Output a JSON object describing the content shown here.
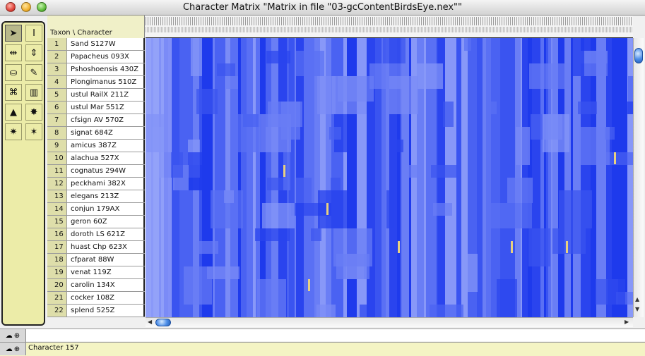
{
  "window": {
    "title": "Character Matrix \"Matrix in file \"03-gcContentBirdsEye.nex\"\""
  },
  "header": {
    "corner_label": "Taxon  \\  Character"
  },
  "tools": [
    {
      "name": "arrow-tool-icon",
      "glyph": "➤",
      "active": true
    },
    {
      "name": "ibeam-tool-icon",
      "glyph": "I",
      "active": false
    },
    {
      "name": "column-adjust-tool-icon",
      "glyph": "⇹",
      "active": false
    },
    {
      "name": "row-adjust-tool-icon",
      "glyph": "⇕",
      "active": false
    },
    {
      "name": "fill-bucket-tool-icon",
      "glyph": "⛀",
      "active": false
    },
    {
      "name": "dropper-tool-icon",
      "glyph": "✎",
      "active": false
    },
    {
      "name": "select-tool-icon",
      "glyph": "⌘",
      "active": false
    },
    {
      "name": "column-width-tool-icon",
      "glyph": "▥",
      "active": false
    },
    {
      "name": "pyramid-tool-icon",
      "glyph": "▲",
      "active": false
    },
    {
      "name": "magic-wand-tool-icon",
      "glyph": "✸",
      "active": false
    },
    {
      "name": "wand-menu-tool-icon",
      "glyph": "✷",
      "active": false
    },
    {
      "name": "wand-alt-tool-icon",
      "glyph": "✶",
      "active": false
    }
  ],
  "taxa": [
    {
      "num": "1",
      "name": "Sand S127W"
    },
    {
      "num": "2",
      "name": "Papacheus 093X"
    },
    {
      "num": "3",
      "name": "Pshoshoensis 430Z"
    },
    {
      "num": "4",
      "name": "Plongimanus 510Z"
    },
    {
      "num": "5",
      "name": "ustul RailX 211Z"
    },
    {
      "num": "6",
      "name": "ustul Mar 551Z"
    },
    {
      "num": "7",
      "name": "cfsign AV 570Z"
    },
    {
      "num": "8",
      "name": "signat 684Z"
    },
    {
      "num": "9",
      "name": "amicus 387Z"
    },
    {
      "num": "10",
      "name": "alachua 527X"
    },
    {
      "num": "11",
      "name": "cognatus 294W"
    },
    {
      "num": "12",
      "name": "peckhami 382X"
    },
    {
      "num": "13",
      "name": "elegans 213Z"
    },
    {
      "num": "14",
      "name": "conjun 179AX"
    },
    {
      "num": "15",
      "name": "geron 60Z"
    },
    {
      "num": "16",
      "name": "doroth LS 621Z"
    },
    {
      "num": "17",
      "name": "huast Chp 623X"
    },
    {
      "num": "18",
      "name": "cfparat 88W"
    },
    {
      "num": "19",
      "name": "venat 119Z"
    },
    {
      "num": "20",
      "name": "carolin 134X"
    },
    {
      "num": "21",
      "name": "cocker 108Z"
    },
    {
      "num": "22",
      "name": "splend 525Z"
    }
  ],
  "status": {
    "text": "Character 157"
  },
  "colors": {
    "palette_bg": "#ececa8",
    "cell_base": "#4a62f2",
    "highlight": "#e8d080",
    "thumb": "#4d8ee8"
  }
}
